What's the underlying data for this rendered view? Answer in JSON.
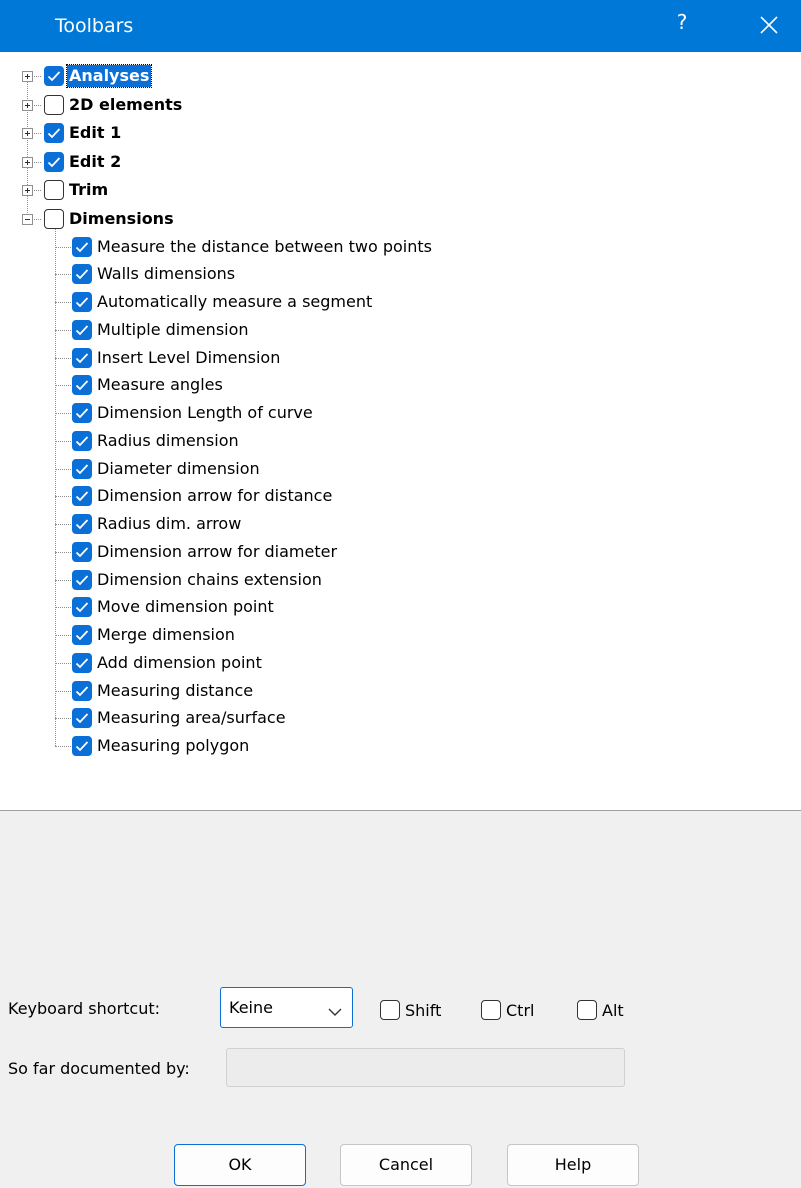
{
  "window": {
    "title": "Toolbars",
    "help_symbol": "?"
  },
  "colors": {
    "accent": "#0078d7",
    "checkbox": "#0a6fd6"
  },
  "tree": {
    "groups": [
      {
        "label": "Analyses",
        "checked": true,
        "expanded": false,
        "selected": true
      },
      {
        "label": "2D elements",
        "checked": false,
        "expanded": false,
        "selected": false
      },
      {
        "label": "Edit 1",
        "checked": true,
        "expanded": false,
        "selected": false
      },
      {
        "label": "Edit 2",
        "checked": true,
        "expanded": false,
        "selected": false
      },
      {
        "label": "Trim",
        "checked": false,
        "expanded": false,
        "selected": false
      },
      {
        "label": "Dimensions",
        "checked": false,
        "expanded": true,
        "selected": false
      }
    ],
    "dimension_items": [
      {
        "label": "Measure the distance between two points",
        "checked": true
      },
      {
        "label": "Walls dimensions",
        "checked": true
      },
      {
        "label": "Automatically measure a segment",
        "checked": true
      },
      {
        "label": "Multiple dimension",
        "checked": true
      },
      {
        "label": "Insert Level Dimension",
        "checked": true
      },
      {
        "label": "Measure angles",
        "checked": true
      },
      {
        "label": "Dimension Length of curve",
        "checked": true
      },
      {
        "label": "Radius dimension",
        "checked": true
      },
      {
        "label": "Diameter dimension",
        "checked": true
      },
      {
        "label": "Dimension arrow for distance",
        "checked": true
      },
      {
        "label": "Radius dim. arrow",
        "checked": true
      },
      {
        "label": "Dimension arrow for diameter",
        "checked": true
      },
      {
        "label": "Dimension chains extension",
        "checked": true
      },
      {
        "label": "Move dimension point",
        "checked": true
      },
      {
        "label": "Merge dimension",
        "checked": true
      },
      {
        "label": "Add dimension point",
        "checked": true
      },
      {
        "label": "Measuring distance",
        "checked": true
      },
      {
        "label": "Measuring area/surface",
        "checked": true
      },
      {
        "label": "Measuring polygon",
        "checked": true
      }
    ]
  },
  "shortcut": {
    "label": "Keyboard shortcut:",
    "key_value": "Keine",
    "modifiers": [
      {
        "label": "Shift",
        "checked": false
      },
      {
        "label": "Ctrl",
        "checked": false
      },
      {
        "label": "Alt",
        "checked": false
      }
    ]
  },
  "documented": {
    "label": "So far documented by:",
    "value": ""
  },
  "buttons": {
    "ok": "OK",
    "cancel": "Cancel",
    "help": "Help"
  }
}
